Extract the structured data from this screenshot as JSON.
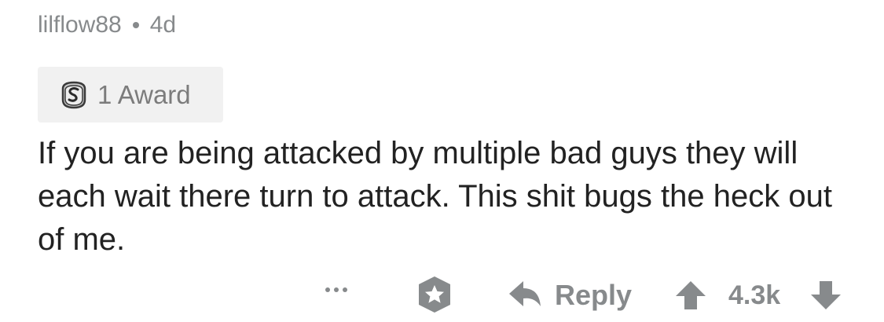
{
  "comment": {
    "username": "lilflow88",
    "age": "4d",
    "award": {
      "icon": "silver-award-icon",
      "label": "1 Award"
    },
    "text": "If you are being attacked by multiple bad guys they will each wait there turn to attack. This shit bugs the heck out of me."
  },
  "actions": {
    "more_icon": "more-dots-icon",
    "save_icon": "save-star-icon",
    "reply_icon": "reply-arrow-icon",
    "reply_label": "Reply",
    "upvote_icon": "upvote-arrow-icon",
    "score": "4.3k",
    "downvote_icon": "downvote-arrow-icon"
  },
  "colors": {
    "meta_text": "#878a8c",
    "body_text": "#222222",
    "award_bg": "#f1f1f1"
  }
}
